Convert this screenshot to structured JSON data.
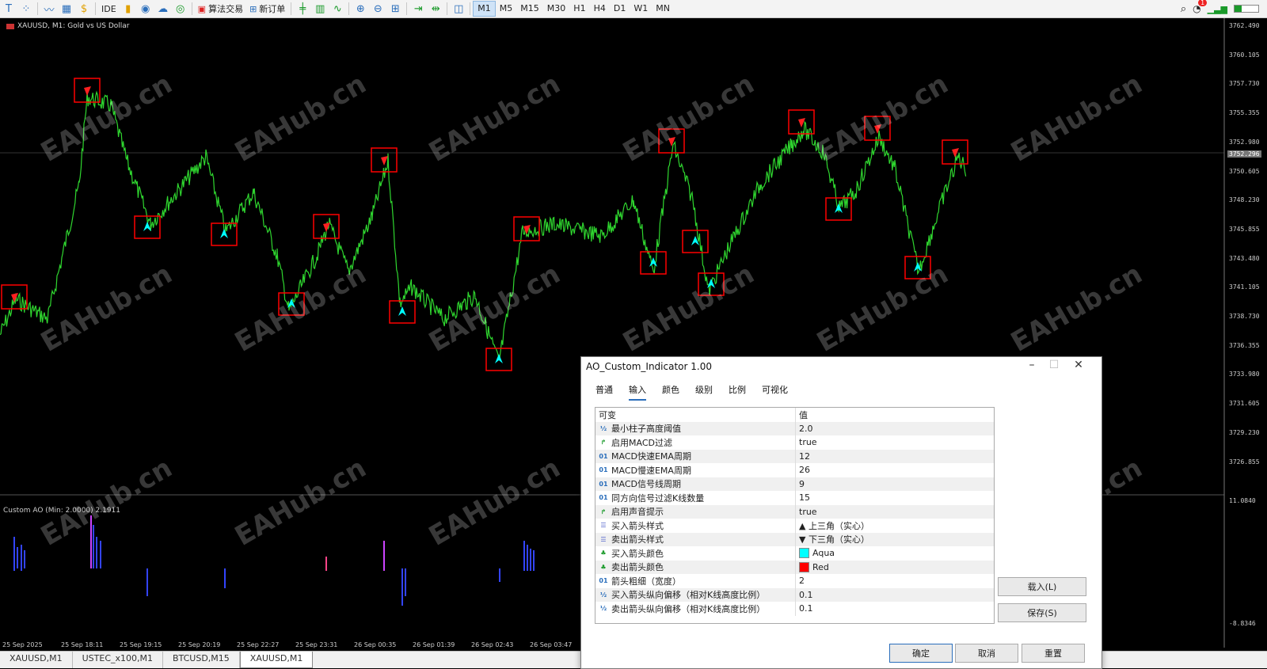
{
  "toolbar": {
    "algo_label": "算法交易",
    "new_order_label": "新订单",
    "ide_label": "IDE",
    "timeframes": [
      "M1",
      "M5",
      "M15",
      "M30",
      "H1",
      "H4",
      "D1",
      "W1",
      "MN"
    ],
    "active_timeframe": "M1",
    "notification_count": "1"
  },
  "chart": {
    "title": "XAUUSD, M1:  Gold vs US Dollar",
    "indicator_title": "Custom AO (Min: 2.0000) 2.1911",
    "current_price": "3752.296",
    "price_labels": [
      "3762.490",
      "3760.105",
      "3757.730",
      "3755.355",
      "3752.980",
      "3750.605",
      "3748.230",
      "3745.855",
      "3743.480",
      "3741.105",
      "3738.730",
      "3736.355",
      "3733.980",
      "3731.605",
      "3729.230",
      "3726.855"
    ],
    "indicator_labels": [
      "11.0840",
      "-8.8346"
    ],
    "time_labels": [
      "25 Sep 2025",
      "25 Sep 18:11",
      "25 Sep 19:15",
      "25 Sep 20:19",
      "25 Sep 22:27",
      "25 Sep 23:31",
      "26 Sep 00:35",
      "26 Sep 01:39",
      "26 Sep 02:43",
      "26 Sep 03:47"
    ],
    "watermark": "EAHub.cn"
  },
  "symbol_tabs": [
    "XAUUSD,M1",
    "USTEC_x100,M1",
    "BTCUSD,M15",
    "XAUUSD,M1"
  ],
  "active_symbol_tab": 3,
  "dialog": {
    "title": "AO_Custom_Indicator 1.00",
    "tabs": [
      "普通",
      "输入",
      "颜色",
      "级别",
      "比例",
      "可视化"
    ],
    "active_tab": 1,
    "col_var": "可变",
    "col_val": "值",
    "params": [
      {
        "type": "½",
        "name": "最小柱子高度阈值",
        "value": "2.0"
      },
      {
        "type": "bool",
        "name": "启用MACD过滤",
        "value": "true"
      },
      {
        "type": "01",
        "name": "MACD快速EMA周期",
        "value": "12"
      },
      {
        "type": "01",
        "name": "MACD慢速EMA周期",
        "value": "26"
      },
      {
        "type": "01",
        "name": "MACD信号线周期",
        "value": "9"
      },
      {
        "type": "01",
        "name": "同方向信号过滤K线数量",
        "value": "15"
      },
      {
        "type": "bool",
        "name": "启用声音提示",
        "value": "true"
      },
      {
        "type": "enum",
        "name": "买入箭头样式",
        "value": "▲ 上三角（实心）"
      },
      {
        "type": "enum",
        "name": "卖出箭头样式",
        "value": "▼ 下三角（实心）"
      },
      {
        "type": "color",
        "name": "买入箭头颜色",
        "value": "Aqua",
        "swatch": "#00ffff"
      },
      {
        "type": "color",
        "name": "卖出箭头颜色",
        "value": "Red",
        "swatch": "#ff0000"
      },
      {
        "type": "01",
        "name": "箭头粗细（宽度）",
        "value": "2"
      },
      {
        "type": "½",
        "name": "买入箭头纵向偏移（相对K线高度比例）",
        "value": "0.1"
      },
      {
        "type": "½",
        "name": "卖出箭头纵向偏移（相对K线高度比例）",
        "value": "0.1"
      }
    ],
    "load_label": "载入(L)",
    "save_label": "保存(S)",
    "ok_label": "确定",
    "cancel_label": "取消",
    "reset_label": "重置"
  },
  "colors": {
    "candle": "#2fd62f",
    "marker": "#ff0000",
    "buy_arrow": "#00ffff",
    "sell_arrow": "#ff2020",
    "accent": "#2a6ebb"
  }
}
